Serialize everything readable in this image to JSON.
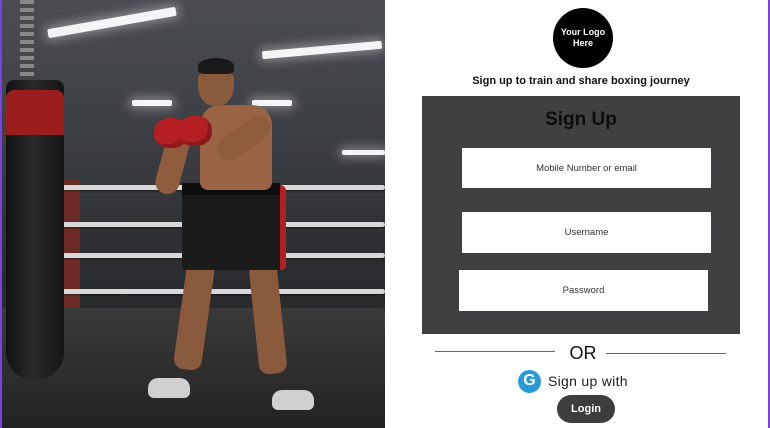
{
  "brand": {
    "logo_text": "Your Logo\nHere"
  },
  "tagline": "Sign up to  train and share boxing  journey",
  "form": {
    "title": "Sign Up",
    "mobile_placeholder": "Mobile Number or email",
    "username_placeholder": "Username",
    "password_placeholder": "Password"
  },
  "divider": {
    "or_text": "OR"
  },
  "google": {
    "icon_glyph": "G",
    "label": "Sign up  with"
  },
  "login": {
    "label": "Login"
  },
  "colors": {
    "card_bg": "#404043",
    "accent_frame": "#7b3fe4",
    "google_blue": "#2a9ad6",
    "button_bg": "#3d3d3f"
  }
}
